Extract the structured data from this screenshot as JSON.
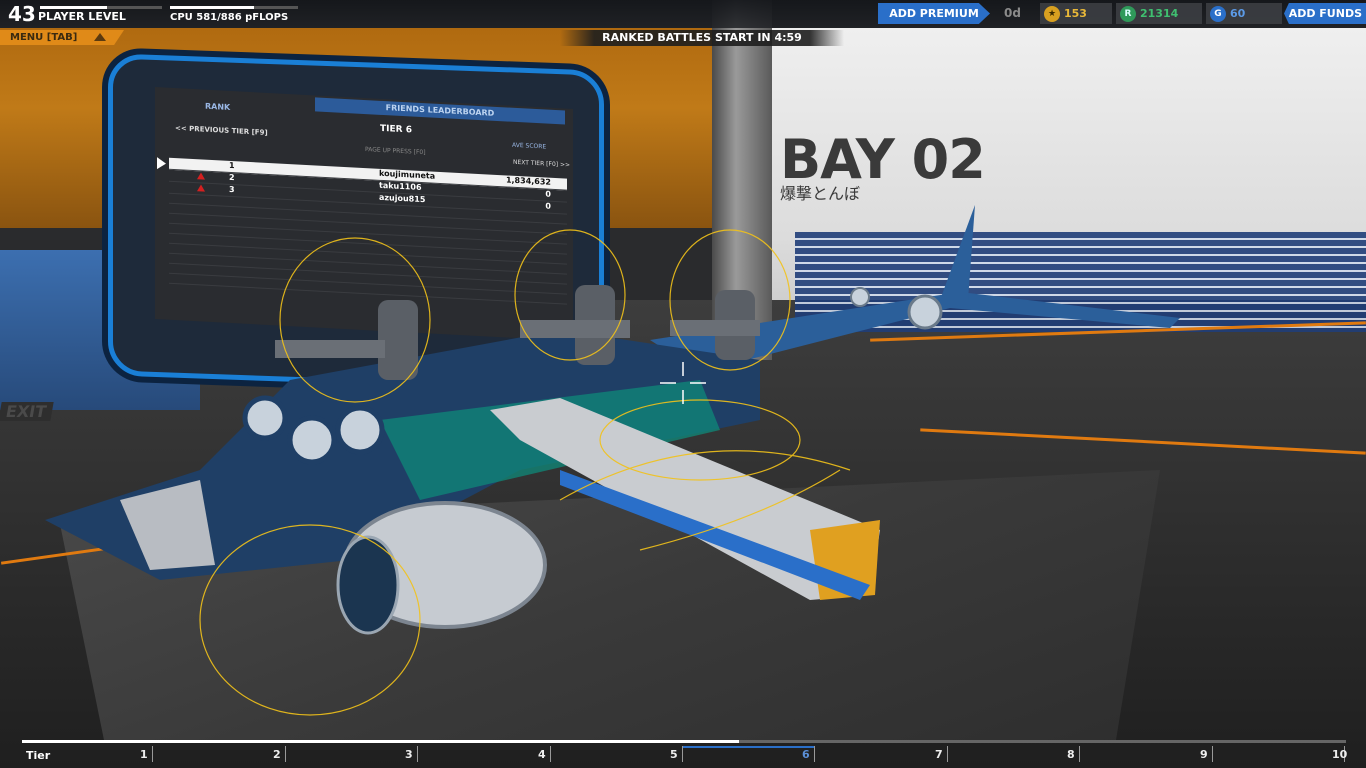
{
  "hud": {
    "player_level": "43",
    "player_level_label": "PLAYER LEVEL",
    "player_level_progress": 0.55,
    "cpu_label": "CPU 581/886 pFLOPS",
    "cpu_progress": 0.66,
    "add_premium": "ADD PREMIUM",
    "premium_days": "0d",
    "stars": "153",
    "robits": "21314",
    "galaxy_coins": "60",
    "add_funds": "ADD FUNDS",
    "menu_label": "MENU [TAB]",
    "ranked_timer": "RANKED BATTLES START IN 4:59"
  },
  "leaderboard": {
    "title": "FRIENDS LEADERBOARD",
    "rank_header": "RANK",
    "tier": "TIER 6",
    "previous_tier": "<< PREVIOUS TIER [F9]",
    "ave_score": "AVE SCORE",
    "page_hint": "PAGE UP PRESS  [F0]",
    "next_tier": "NEXT TIER [F0] >>",
    "rows": [
      {
        "rank": "1",
        "name": "koujimuneta",
        "score": "1,834,632",
        "me": true
      },
      {
        "rank": "2",
        "name": "taku1106",
        "score": "0"
      },
      {
        "rank": "3",
        "name": "azujou815",
        "score": "0"
      }
    ]
  },
  "bay": {
    "title": "BAY 02",
    "subtitle": "爆撃とんぼ"
  },
  "exit": "EXIT",
  "tiers": {
    "label": "Tier",
    "numbers": [
      "1",
      "2",
      "3",
      "4",
      "5",
      "6",
      "7",
      "8",
      "9",
      "10"
    ],
    "active": "6"
  },
  "colors": {
    "accent_blue": "#2a6fc9",
    "menu_orange": "#e08a18",
    "monitor_blue": "#1a7fd6"
  }
}
